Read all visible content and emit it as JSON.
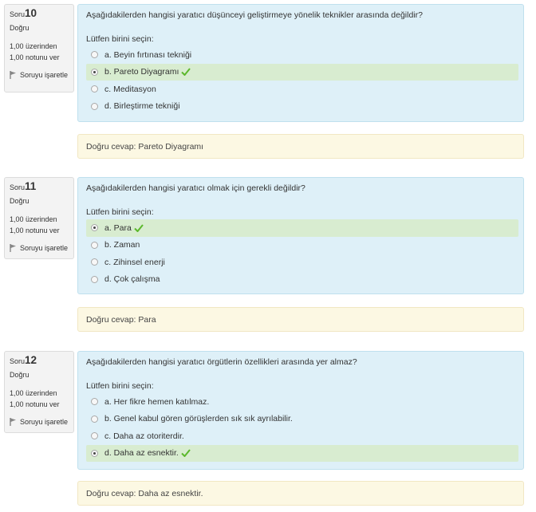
{
  "questions": [
    {
      "soru_label": "Soru",
      "number": "10",
      "state": "Doğru",
      "grade_line1": "1,00 üzerinden",
      "grade_line2": "1,00 notunu ver",
      "flag_label": "Soruyu işaretle",
      "question_text": "Aşağıdakilerden hangisi yaratıcı düşünceyi geliştirmeye yönelik teknikler arasında değildir?",
      "prompt": "Lütfen birini seçin:",
      "options": [
        {
          "label": "a. Beyin fırtınası tekniği",
          "selected": false,
          "correct": false
        },
        {
          "label": "b. Pareto Diyagramı",
          "selected": true,
          "correct": true
        },
        {
          "label": "c. Meditasyon",
          "selected": false,
          "correct": false
        },
        {
          "label": "d. Birleştirme tekniği",
          "selected": false,
          "correct": false
        }
      ],
      "right_answer": "Doğru cevap: Pareto Diyagramı"
    },
    {
      "soru_label": "Soru",
      "number": "11",
      "state": "Doğru",
      "grade_line1": "1,00 üzerinden",
      "grade_line2": "1,00 notunu ver",
      "flag_label": "Soruyu işaretle",
      "question_text": "Aşağıdakilerden hangisi yaratıcı olmak için gerekli değildir?",
      "prompt": "Lütfen birini seçin:",
      "options": [
        {
          "label": "a. Para",
          "selected": true,
          "correct": true
        },
        {
          "label": "b. Zaman",
          "selected": false,
          "correct": false
        },
        {
          "label": "c. Zihinsel enerji",
          "selected": false,
          "correct": false
        },
        {
          "label": "d. Çok çalışma",
          "selected": false,
          "correct": false
        }
      ],
      "right_answer": "Doğru cevap: Para"
    },
    {
      "soru_label": "Soru",
      "number": "12",
      "state": "Doğru",
      "grade_line1": "1,00 üzerinden",
      "grade_line2": "1,00 notunu ver",
      "flag_label": "Soruyu işaretle",
      "question_text": "Aşağıdakilerden hangisi yaratıcı örgütlerin özellikleri arasında yer almaz?",
      "prompt": "Lütfen birini seçin:",
      "options": [
        {
          "label": "a. Her fikre hemen katılmaz.",
          "selected": false,
          "correct": false
        },
        {
          "label": "b. Genel kabul gören görüşlerden sık sık ayrılabilir.",
          "selected": false,
          "correct": false
        },
        {
          "label": "c. Daha az otoriterdir.",
          "selected": false,
          "correct": false
        },
        {
          "label": "d. Daha az esnektir.",
          "selected": true,
          "correct": true
        }
      ],
      "right_answer": "Doğru cevap: Daha az esnektir."
    }
  ],
  "colors": {
    "formulation_bg": "#def0f8",
    "correct_bg": "#d8ecd0",
    "outcome_bg": "#fcf8e3",
    "info_bg": "#f3f3f3",
    "tick": "#5cb82c"
  },
  "icons": {
    "flag": "flag-icon",
    "tick": "check-icon"
  }
}
